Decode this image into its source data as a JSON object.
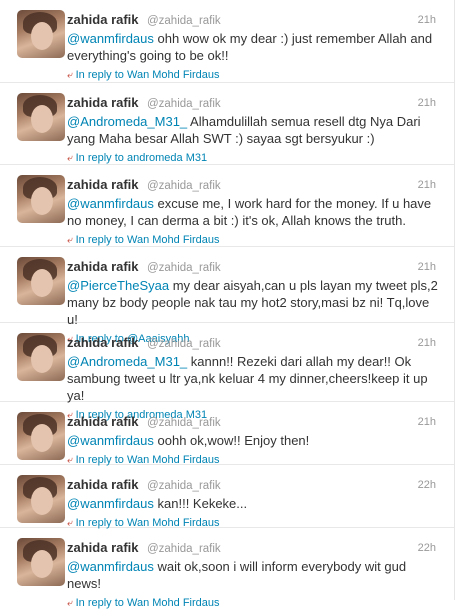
{
  "user": {
    "fullname": "zahida rafik",
    "username": "@zahida_rafik"
  },
  "tweets": [
    {
      "time": "21h",
      "mention": "@wanmfirdaus",
      "text": " ohh wow ok my dear :) just remember Allah and everything's going to be ok!!",
      "reply_prefix": "In reply to",
      "reply_name": "Wan Mohd Firdaus"
    },
    {
      "time": "21h",
      "mention": "@Andromeda_M31_",
      "text": " Alhamdulillah semua resell dtg Nya Dari yang Maha besar Allah SWT :) sayaa sgt bersyukur :)",
      "reply_prefix": "In reply to",
      "reply_name": "andromeda M31"
    },
    {
      "time": "21h",
      "mention": "@wanmfirdaus",
      "text": " excuse me, I work hard for the money. If u have no money, I can derma a bit :) it's ok, Allah knows the truth.",
      "reply_prefix": "In reply to",
      "reply_name": "Wan Mohd Firdaus"
    },
    {
      "time": "21h",
      "mention": "@PierceTheSyaa",
      "text": " my dear aisyah,can u pls layan my tweet pls,2 many bz body people nak tau my hot2 story,masi bz ni! Tq,love u!",
      "reply_prefix": "In reply to",
      "reply_name": "@Aaaisyahh"
    },
    {
      "time": "21h",
      "mention": "@Andromeda_M31_",
      "text": " kannn!! Rezeki dari allah my dear!! Ok sambung tweet u ltr ya,nk keluar 4 my dinner,cheers!keep it up ya!",
      "reply_prefix": "In reply to",
      "reply_name": "andromeda M31"
    },
    {
      "time": "21h",
      "mention": "@wanmfirdaus",
      "text": " oohh ok,wow!! Enjoy then!",
      "reply_prefix": "In reply to",
      "reply_name": "Wan Mohd Firdaus"
    },
    {
      "time": "22h",
      "mention": "@wanmfirdaus",
      "text": " kan!!! Kekeke...",
      "reply_prefix": "In reply to",
      "reply_name": "Wan Mohd Firdaus"
    },
    {
      "time": "22h",
      "mention": "@wanmfirdaus",
      "text": " wait ok,soon i will inform everybody wit gud news!",
      "reply_prefix": "In reply to",
      "reply_name": "Wan Mohd Firdaus"
    }
  ]
}
